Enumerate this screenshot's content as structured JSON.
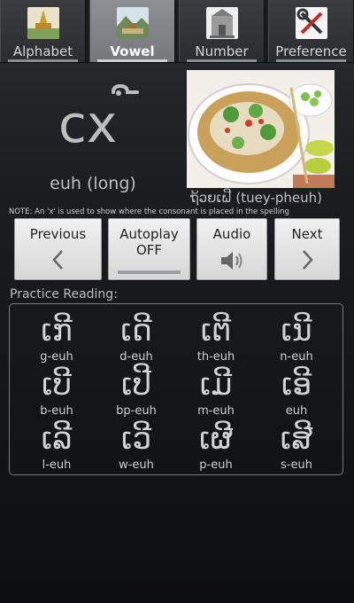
{
  "tabs": [
    {
      "label": "Alphabet",
      "icon": "temple-photo-icon",
      "active": false
    },
    {
      "label": "Vowel",
      "icon": "landscape-photo-icon",
      "active": true
    },
    {
      "label": "Number",
      "icon": "monument-photo-icon",
      "active": false
    },
    {
      "label": "Preference",
      "icon": "tools-icon",
      "active": false
    }
  ],
  "lesson": {
    "letter": "cx",
    "sound": "euh (long)",
    "caption": "ຖ້ວຍເຝີ (tuey-pheuh)",
    "note": "NOTE: An 'x' is used to show where the consonant is placed in the spelling"
  },
  "controls": {
    "previous": "Previous",
    "autoplay": "Autoplay",
    "autoplay_state": "OFF",
    "audio": "Audio",
    "next": "Next"
  },
  "practice": {
    "title": "Practice Reading:",
    "items": [
      {
        "lao": "ເກີ",
        "roman": "g-euh"
      },
      {
        "lao": "ເດີ",
        "roman": "d-euh"
      },
      {
        "lao": "ເຕີ",
        "roman": "th-euh"
      },
      {
        "lao": "ເນີ",
        "roman": "n-euh"
      },
      {
        "lao": "ເບີ",
        "roman": "b-euh"
      },
      {
        "lao": "ເປີ",
        "roman": "bp-euh"
      },
      {
        "lao": "ເມີ",
        "roman": "m-euh"
      },
      {
        "lao": "ເອີ",
        "roman": "euh"
      },
      {
        "lao": "ເລີ",
        "roman": "l-euh"
      },
      {
        "lao": "ເວີ",
        "roman": "w-euh"
      },
      {
        "lao": "ເຜີ",
        "roman": "p-euh"
      },
      {
        "lao": "ເສີ",
        "roman": "s-euh"
      }
    ]
  }
}
